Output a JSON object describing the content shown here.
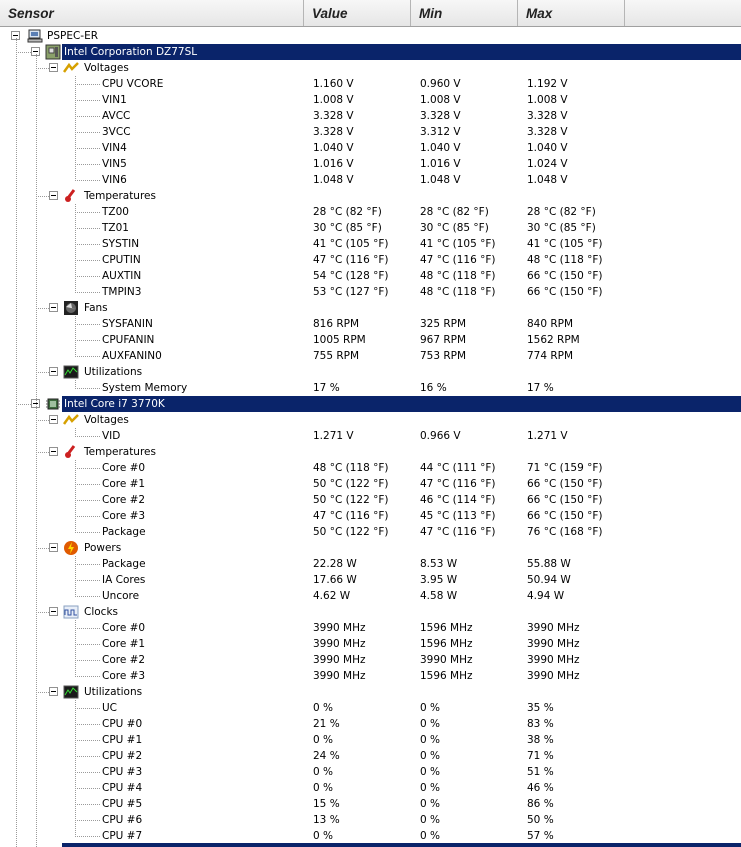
{
  "header": {
    "columns": [
      "Sensor",
      "Value",
      "Min",
      "Max"
    ]
  },
  "colors": {
    "selection": "#0a246a"
  },
  "tree": {
    "root": "PSPEC-ER",
    "devices": [
      {
        "name": "Intel Corporation DZ77SL",
        "icon": "motherboard-icon",
        "groups": [
          {
            "name": "Voltages",
            "icon": "voltage-icon",
            "rows": [
              [
                "CPU VCORE",
                "1.160 V",
                "0.960 V",
                "1.192 V"
              ],
              [
                "VIN1",
                "1.008 V",
                "1.008 V",
                "1.008 V"
              ],
              [
                "AVCC",
                "3.328 V",
                "3.328 V",
                "3.328 V"
              ],
              [
                "3VCC",
                "3.328 V",
                "3.312 V",
                "3.328 V"
              ],
              [
                "VIN4",
                "1.040 V",
                "1.040 V",
                "1.040 V"
              ],
              [
                "VIN5",
                "1.016 V",
                "1.016 V",
                "1.024 V"
              ],
              [
                "VIN6",
                "1.048 V",
                "1.048 V",
                "1.048 V"
              ]
            ]
          },
          {
            "name": "Temperatures",
            "icon": "thermometer-icon",
            "rows": [
              [
                "TZ00",
                "28 °C  (82 °F)",
                "28 °C  (82 °F)",
                "28 °C  (82 °F)"
              ],
              [
                "TZ01",
                "30 °C  (85 °F)",
                "30 °C  (85 °F)",
                "30 °C  (85 °F)"
              ],
              [
                "SYSTIN",
                "41 °C  (105 °F)",
                "41 °C  (105 °F)",
                "41 °C  (105 °F)"
              ],
              [
                "CPUTIN",
                "47 °C  (116 °F)",
                "47 °C  (116 °F)",
                "48 °C  (118 °F)"
              ],
              [
                "AUXTIN",
                "54 °C  (128 °F)",
                "48 °C  (118 °F)",
                "66 °C  (150 °F)"
              ],
              [
                "TMPIN3",
                "53 °C  (127 °F)",
                "48 °C  (118 °F)",
                "66 °C  (150 °F)"
              ]
            ]
          },
          {
            "name": "Fans",
            "icon": "fan-icon",
            "rows": [
              [
                "SYSFANIN",
                "816 RPM",
                "325 RPM",
                "840 RPM"
              ],
              [
                "CPUFANIN",
                "1005 RPM",
                "967 RPM",
                "1562 RPM"
              ],
              [
                "AUXFANIN0",
                "755 RPM",
                "753 RPM",
                "774 RPM"
              ]
            ]
          },
          {
            "name": "Utilizations",
            "icon": "utilization-icon",
            "rows": [
              [
                "System Memory",
                "17 %",
                "16 %",
                "17 %"
              ]
            ]
          }
        ]
      },
      {
        "name": "Intel Core i7 3770K",
        "icon": "cpu-icon",
        "groups": [
          {
            "name": "Voltages",
            "icon": "voltage-icon",
            "rows": [
              [
                "VID",
                "1.271 V",
                "0.966 V",
                "1.271 V"
              ]
            ]
          },
          {
            "name": "Temperatures",
            "icon": "thermometer-icon",
            "rows": [
              [
                "Core #0",
                "48 °C  (118 °F)",
                "44 °C  (111 °F)",
                "71 °C  (159 °F)"
              ],
              [
                "Core #1",
                "50 °C  (122 °F)",
                "47 °C  (116 °F)",
                "66 °C  (150 °F)"
              ],
              [
                "Core #2",
                "50 °C  (122 °F)",
                "46 °C  (114 °F)",
                "66 °C  (150 °F)"
              ],
              [
                "Core #3",
                "47 °C  (116 °F)",
                "45 °C  (113 °F)",
                "66 °C  (150 °F)"
              ],
              [
                "Package",
                "50 °C  (122 °F)",
                "47 °C  (116 °F)",
                "76 °C  (168 °F)"
              ]
            ]
          },
          {
            "name": "Powers",
            "icon": "power-icon",
            "rows": [
              [
                "Package",
                "22.28 W",
                "8.53 W",
                "55.88 W"
              ],
              [
                "IA Cores",
                "17.66 W",
                "3.95 W",
                "50.94 W"
              ],
              [
                "Uncore",
                "4.62 W",
                "4.58 W",
                "4.94 W"
              ]
            ]
          },
          {
            "name": "Clocks",
            "icon": "clock-icon",
            "rows": [
              [
                "Core #0",
                "3990 MHz",
                "1596 MHz",
                "3990 MHz"
              ],
              [
                "Core #1",
                "3990 MHz",
                "1596 MHz",
                "3990 MHz"
              ],
              [
                "Core #2",
                "3990 MHz",
                "3990 MHz",
                "3990 MHz"
              ],
              [
                "Core #3",
                "3990 MHz",
                "1596 MHz",
                "3990 MHz"
              ]
            ]
          },
          {
            "name": "Utilizations",
            "icon": "utilization-icon",
            "rows": [
              [
                "UC",
                "0 %",
                "0 %",
                "35 %"
              ],
              [
                "CPU #0",
                "21 %",
                "0 %",
                "83 %"
              ],
              [
                "CPU #1",
                "0 %",
                "0 %",
                "38 %"
              ],
              [
                "CPU #2",
                "24 %",
                "0 %",
                "71 %"
              ],
              [
                "CPU #3",
                "0 %",
                "0 %",
                "51 %"
              ],
              [
                "CPU #4",
                "0 %",
                "0 %",
                "46 %"
              ],
              [
                "CPU #5",
                "15 %",
                "0 %",
                "86 %"
              ],
              [
                "CPU #6",
                "13 %",
                "0 %",
                "50 %"
              ],
              [
                "CPU #7",
                "0 %",
                "0 %",
                "57 %"
              ]
            ]
          }
        ]
      }
    ]
  }
}
